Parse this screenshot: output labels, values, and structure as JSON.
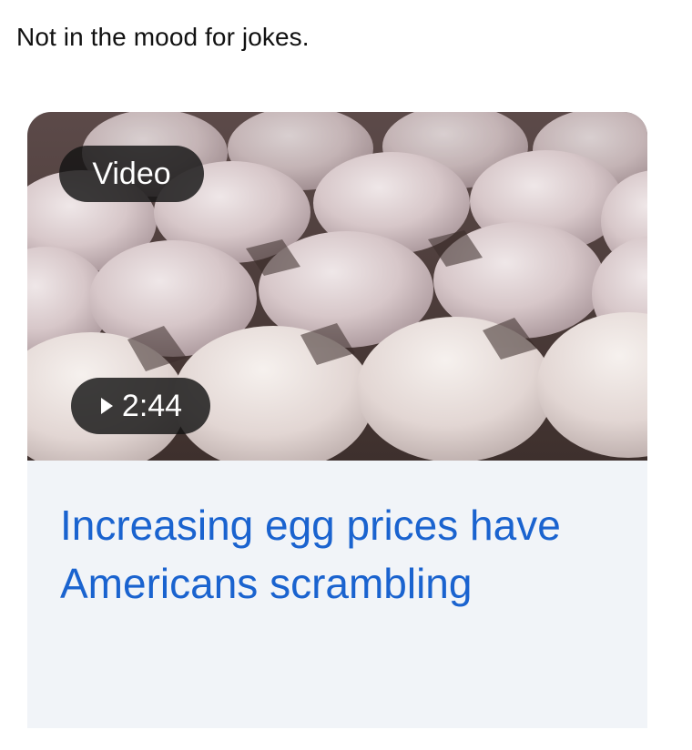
{
  "post": {
    "caption": "Not in the mood for jokes."
  },
  "card": {
    "video_label": "Video",
    "duration": "2:44",
    "play_icon": "play-icon",
    "headline": "Increasing egg prices have Americans scrambling",
    "headline_color": "#1a63cf",
    "background_color": "#f1f4f8"
  }
}
